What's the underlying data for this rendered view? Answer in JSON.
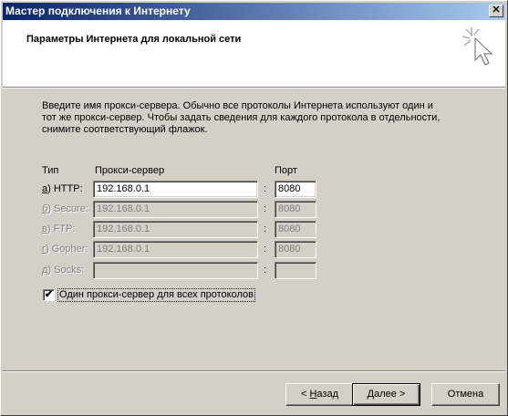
{
  "window": {
    "title": "Мастер подключения к Интернету",
    "close_glyph": "✕"
  },
  "header": {
    "title": "Параметры Интернета для локальной сети",
    "icon": "wizard-cursor-icon"
  },
  "description": "Введите имя прокси-сервера. Обычно все протоколы Интернета используют один и тот же прокси-сервер. Чтобы задать сведения для каждого протокола в отдельности, снимите соответствующий флажок.",
  "columns": {
    "type": "Тип",
    "proxy": "Прокси-сервер",
    "port": "Порт"
  },
  "rows": [
    {
      "hotkey": "а",
      "label": ") HTTP:",
      "server": "192.168.0.1",
      "port": "8080",
      "enabled": true
    },
    {
      "hotkey": "б",
      "label": ") Secure:",
      "server": "192.168.0.1",
      "port": "8080",
      "enabled": false
    },
    {
      "hotkey": "в",
      "label": ") FTP:",
      "server": "192.168.0.1",
      "port": "8080",
      "enabled": false
    },
    {
      "hotkey": "г",
      "label": ") Gopher:",
      "server": "192.168.0.1",
      "port": "8080",
      "enabled": false
    },
    {
      "hotkey": "д",
      "label": ") Socks:",
      "server": "",
      "port": "",
      "enabled": false
    }
  ],
  "colon": ":",
  "same_proxy": {
    "label": "Один прокси-сервер для всех протоколов",
    "checked": true,
    "check_glyph": "✔"
  },
  "buttons": {
    "back": {
      "prefix": "< ",
      "hotkey": "Н",
      "rest": "азад"
    },
    "next": {
      "label": "Далее >"
    },
    "cancel": {
      "label": "Отмена"
    }
  }
}
